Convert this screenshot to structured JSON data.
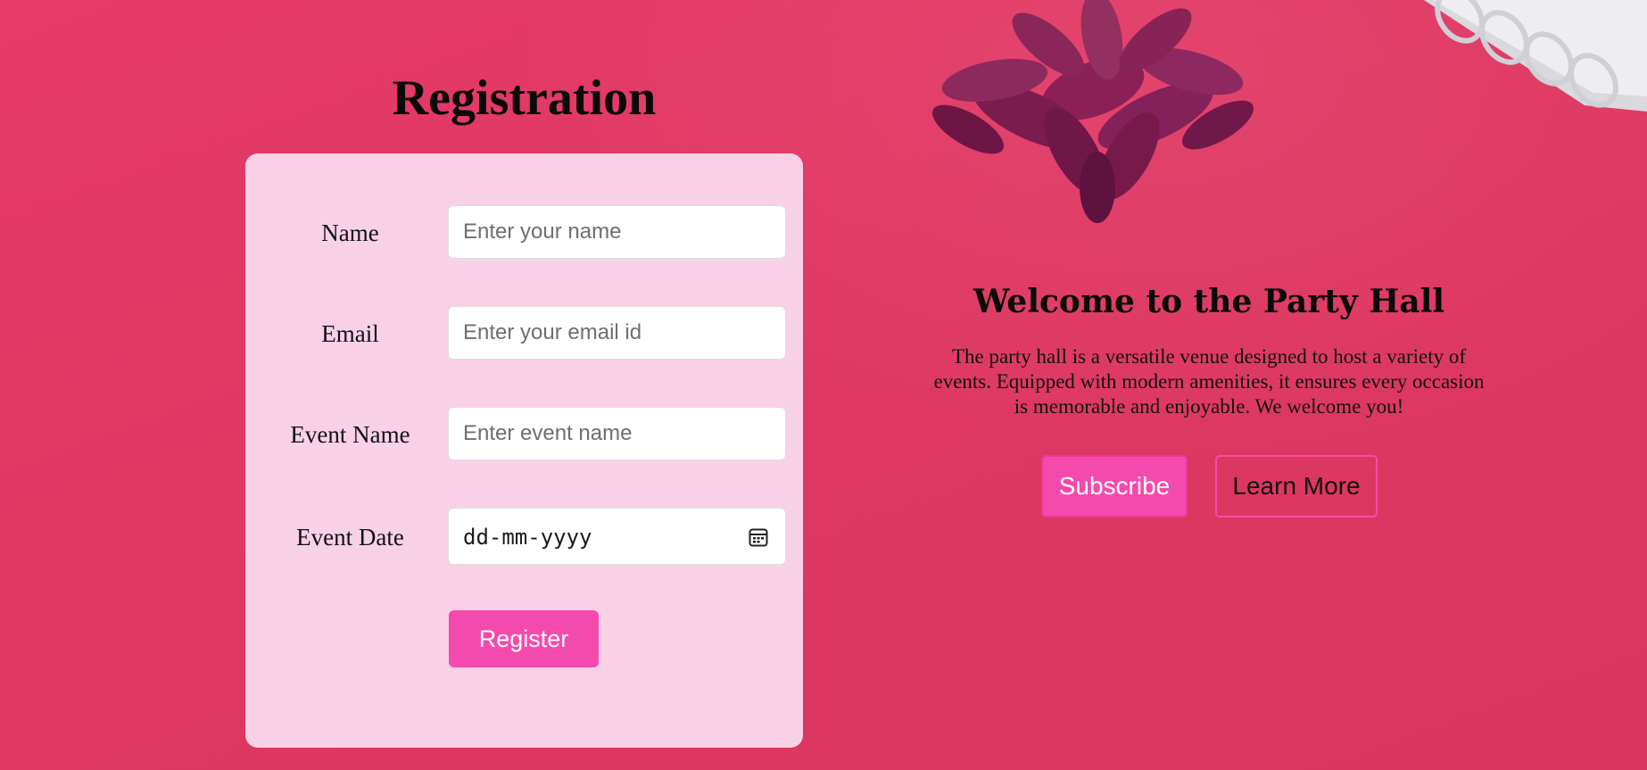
{
  "colors": {
    "background": "#e03a65",
    "card": "#fad7ec",
    "accent": "#f54aad"
  },
  "registration": {
    "title": "Registration",
    "fields": [
      {
        "label": "Name",
        "placeholder": "Enter your name"
      },
      {
        "label": "Email",
        "placeholder": "Enter your email id"
      },
      {
        "label": "Event Name",
        "placeholder": "Enter event name"
      },
      {
        "label": "Event Date",
        "placeholder": "dd-mm-yyyy",
        "icon": "calendar-icon"
      }
    ],
    "register_label": "Register"
  },
  "welcome": {
    "title": "Welcome to the Party Hall",
    "description": "The party hall is a versatile venue designed to host a variety of events. Equipped with modern amenities, it ensures every occasion is memorable and enjoyable. We welcome you!",
    "subscribe_label": "Subscribe",
    "learn_more_label": "Learn More"
  }
}
